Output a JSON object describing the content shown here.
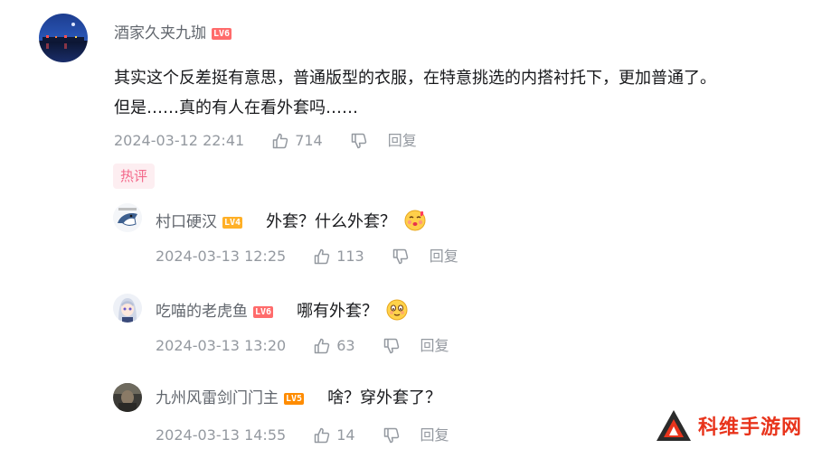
{
  "main_comment": {
    "username": "酒家久夹九珈",
    "level": "LV6",
    "level_color": "#ff6b6b",
    "lines": [
      "其实这个反差挺有意思，普通版型的衣服，在特意挑选的内搭衬托下，更加普通了。",
      "但是……真的有人在看外套吗……"
    ],
    "timestamp": "2024-03-12 22:41",
    "likes": "714",
    "reply_label": "回复",
    "hot_badge": "热评"
  },
  "replies": [
    {
      "username": "村口硬汉",
      "level": "LV4",
      "level_color": "#ffb027",
      "text": "外套？什么外套？",
      "emoji": "kiss-face-icon",
      "timestamp": "2024-03-13 12:25",
      "likes": "113",
      "reply_label": "回复"
    },
    {
      "username": "吃喵的老虎鱼",
      "level": "LV6",
      "level_color": "#ff6b6b",
      "text": "哪有外套？",
      "emoji": "blush-face-icon",
      "timestamp": "2024-03-13 13:20",
      "likes": "63",
      "reply_label": "回复"
    },
    {
      "username": "九州风雷剑门门主",
      "level": "LV5",
      "level_color": "#ff8c00",
      "text": "啥？穿外套了？",
      "emoji": "",
      "timestamp": "2024-03-13 14:55",
      "likes": "14",
      "reply_label": "回复"
    }
  ],
  "watermark": {
    "text": "科维手游网",
    "color": "#e8341c"
  }
}
